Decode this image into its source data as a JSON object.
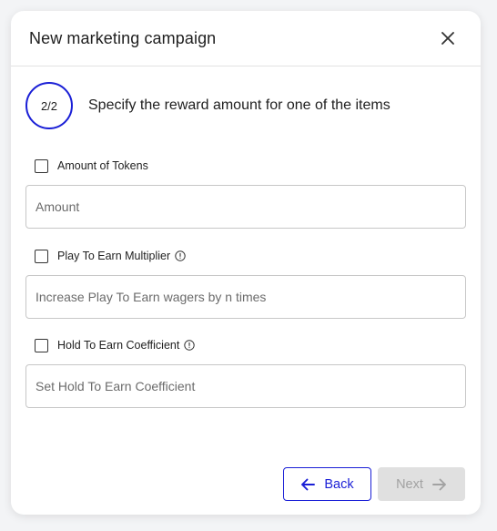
{
  "modal": {
    "title": "New marketing campaign"
  },
  "step": {
    "indicator": "2/2",
    "description": "Specify the reward amount for one of the items"
  },
  "options": [
    {
      "label": "Amount of Tokens",
      "placeholder": "Amount",
      "value": "",
      "checked": false,
      "has_info_icon": false
    },
    {
      "label": "Play To Earn Multiplier",
      "placeholder": "Increase Play To Earn wagers by n times",
      "value": "",
      "checked": false,
      "has_info_icon": true
    },
    {
      "label": "Hold To Earn Coefficient",
      "placeholder": "Set Hold To Earn Coefficient",
      "value": "",
      "checked": false,
      "has_info_icon": true
    }
  ],
  "footer": {
    "back_label": "Back",
    "next_label": "Next",
    "next_disabled": true
  },
  "icons": {
    "close": "close-icon",
    "info": "info-circle-icon",
    "back": "arrow-left-icon",
    "next": "arrow-right-icon"
  },
  "colors": {
    "accent": "#1a1fd6",
    "disabled_bg": "#e0e0e0",
    "disabled_text": "#a2a2a2"
  }
}
